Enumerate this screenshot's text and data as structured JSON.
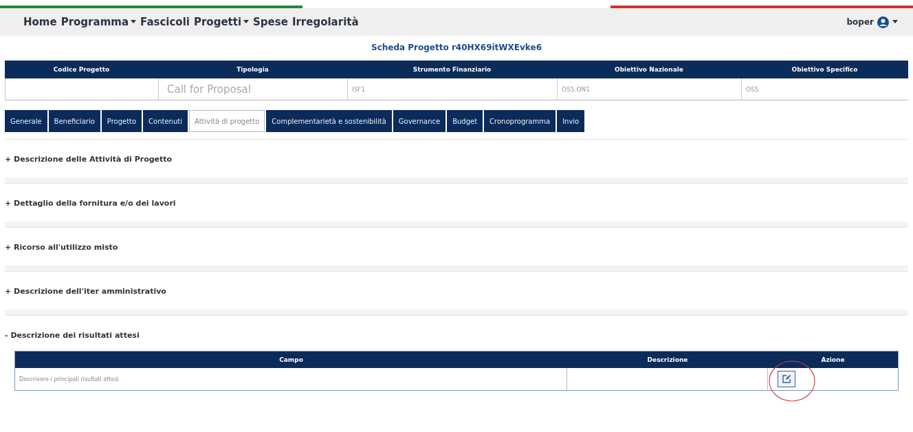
{
  "nav": {
    "items": [
      {
        "label": "Home",
        "dropdown": false
      },
      {
        "label": "Programma",
        "dropdown": true
      },
      {
        "label": "Fascicoli",
        "dropdown": false
      },
      {
        "label": "Progetti",
        "dropdown": true
      },
      {
        "label": "Spese",
        "dropdown": false
      },
      {
        "label": "Irregolarità",
        "dropdown": false
      }
    ],
    "user": "boper"
  },
  "page_title": "Scheda Progetto r40HX69itWXEvke6",
  "summary": {
    "columns": [
      {
        "header": "Codice Progetto"
      },
      {
        "header": "Tipologia",
        "value": "Call for Proposal"
      },
      {
        "header": "Strumento Finanziario",
        "value": "ISF1"
      },
      {
        "header": "Obiettivo Nazionale",
        "value": "OS5.ON1"
      },
      {
        "header": "Obiettivo Specifico",
        "value": "OS5"
      }
    ]
  },
  "tabs": [
    {
      "label": "Generale",
      "selected": false
    },
    {
      "label": "Beneficiario",
      "selected": false
    },
    {
      "label": "Progetto",
      "selected": false
    },
    {
      "label": "Contenuti",
      "selected": false
    },
    {
      "label": "Attività di progetto",
      "selected": true
    },
    {
      "label": "Complementarietà e sostenibilità",
      "selected": false
    },
    {
      "label": "Governance",
      "selected": false
    },
    {
      "label": "Budget",
      "selected": false
    },
    {
      "label": "Cronoprogramma",
      "selected": false
    },
    {
      "label": "Invio",
      "selected": false
    }
  ],
  "sections": [
    {
      "sign": "+",
      "title": "Descrizione delle Attività di Progetto",
      "expanded": false
    },
    {
      "sign": "+",
      "title": "Dettaglio della fornitura e/o dei lavori",
      "expanded": false
    },
    {
      "sign": "+",
      "title": "Ricorso all'utilizzo misto",
      "expanded": false
    },
    {
      "sign": "+",
      "title": "Descrizione dell'iter amministrativo",
      "expanded": false
    },
    {
      "sign": "-",
      "title": "Descrizione dei risultati attesi",
      "expanded": true,
      "table": {
        "columns": [
          "Campo",
          "Descrizione",
          "Azione"
        ],
        "rows": [
          {
            "campo": "Descrivere i principali risultati attesi",
            "descrizione": ""
          }
        ]
      }
    }
  ]
}
